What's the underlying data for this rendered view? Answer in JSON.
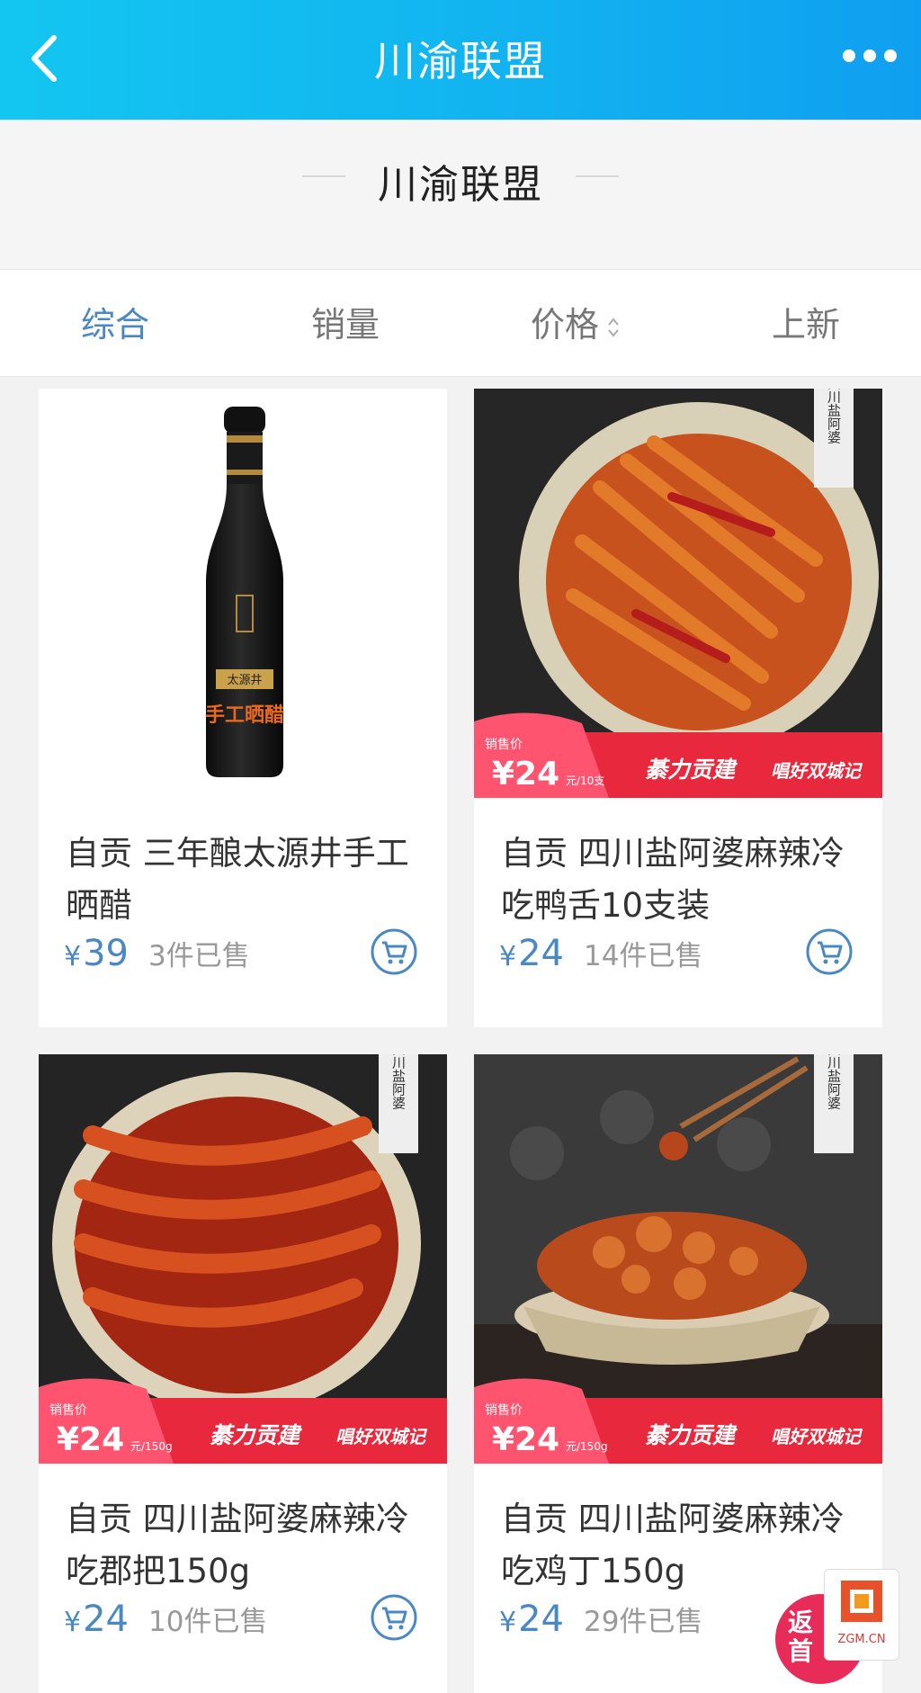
{
  "header": {
    "title": "川渝联盟",
    "back_icon": "back-chevron-icon",
    "more_icon": "more-dots-icon"
  },
  "section": {
    "title": "川渝联盟"
  },
  "sort_tabs": [
    {
      "label": "综合",
      "active": true
    },
    {
      "label": "销量",
      "active": false
    },
    {
      "label": "价格",
      "active": false
    },
    {
      "label": "上新",
      "active": false
    }
  ],
  "products": [
    {
      "name": "自贡 三年酿太源井手工晒醋",
      "price_symbol": "¥",
      "price": "39",
      "sold": "3件已售",
      "bottle_brand": "太源井",
      "bottle_text": "手工晒醋"
    },
    {
      "name": "自贡 四川盐阿婆麻辣冷吃鸭舌10支装",
      "price_symbol": "¥",
      "price": "24",
      "sold": "14件已售",
      "promo": {
        "label": "销售价",
        "price": "¥24",
        "unit": "元/10支",
        "slogan1": "綦力贡建",
        "slogan2": "唱好双城记"
      },
      "tag": "四川盐阿婆"
    },
    {
      "name": "自贡 四川盐阿婆麻辣冷吃郡把150g",
      "price_symbol": "¥",
      "price": "24",
      "sold": "10件已售",
      "promo": {
        "label": "销售价",
        "price": "¥24",
        "unit": "元/150g",
        "slogan1": "綦力贡建",
        "slogan2": "唱好双城记"
      },
      "tag": "四川盐阿婆"
    },
    {
      "name": "自贡 四川盐阿婆麻辣冷吃鸡丁150g",
      "price_symbol": "¥",
      "price": "24",
      "sold": "29件已售",
      "promo": {
        "label": "销售价",
        "price": "¥24",
        "unit": "元/150g",
        "slogan1": "綦力贡建",
        "slogan2": "唱好双城记"
      },
      "tag": "四川盐阿婆"
    }
  ],
  "float_badge": {
    "text": "返首"
  },
  "watermark": {
    "text": "ZGM.CN"
  },
  "colors": {
    "header": "#12b3f0",
    "accent": "#4a88c4",
    "promo_red": "#e8283c"
  }
}
